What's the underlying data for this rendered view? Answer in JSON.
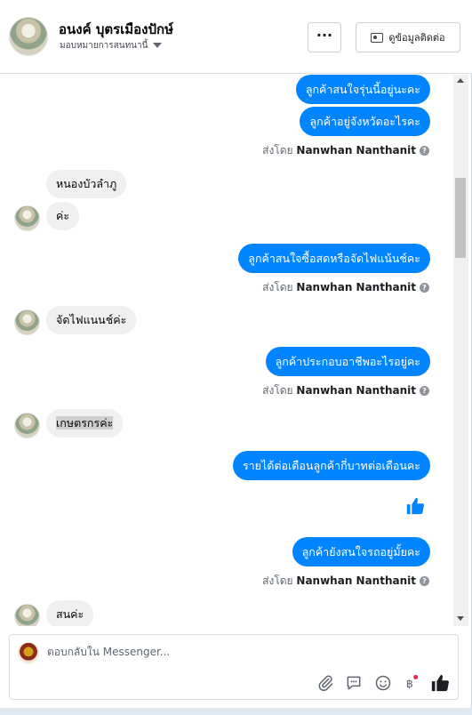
{
  "header": {
    "name": "อนงค์ บุตรเมืองปักษ์",
    "assign_label": "มอบหมายการสนทนานี้",
    "more_label": "···",
    "contact_label": "ดูข้อมูลติดต่อ"
  },
  "thread": {
    "messages": [
      {
        "side": "out",
        "text": "ลูกค้าสนใจรุ่นนี้อยู่นะคะ"
      },
      {
        "side": "out",
        "text": "ลูกค้าอยู่จังหวัดอะไรคะ"
      },
      {
        "side": "in",
        "text": "หนองบัวลำภู"
      },
      {
        "side": "in",
        "text": "ค่ะ"
      },
      {
        "side": "out",
        "text": "ลูกค้าสนใจซื้อสดหรือจัดไฟแน้นช์คะ"
      },
      {
        "side": "in",
        "text": "จัดไฟแนนช์ค่ะ"
      },
      {
        "side": "out",
        "text": "ลูกค้าประกอบอาชีพอะไรอยู่คะ"
      },
      {
        "side": "in",
        "text": "เกษตรกรค่ะ"
      },
      {
        "side": "out",
        "text": "รายได้ต่อเดือนลูกค้ากี่บาทต่อเดือนคะ"
      },
      {
        "side": "out",
        "text": "ลูกค้ายังสนใจรถอยู่มั้ยคะ"
      },
      {
        "side": "in",
        "text": "สนค่ะ"
      }
    ],
    "sent_by_prefix": "ส่งโดย",
    "sent_by_name": "Nanwhan Nanthanit"
  },
  "composer": {
    "placeholder": "ตอบกลับใน Messenger..."
  },
  "colors": {
    "outgoing_bubble": "#0084ff",
    "incoming_bubble": "#f0f0f0",
    "accent": "#0084ff"
  },
  "icons": [
    "caret-down-icon",
    "more-icon",
    "contact-card-icon",
    "info-icon",
    "thumbs-up-icon",
    "attachment-icon",
    "quick-reply-icon",
    "emoji-icon",
    "payment-icon"
  ]
}
